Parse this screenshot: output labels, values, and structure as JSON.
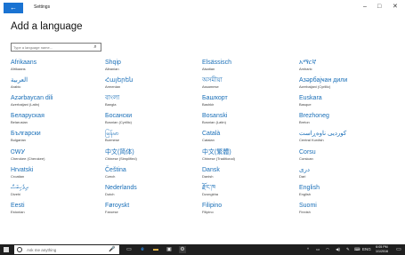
{
  "app": {
    "back_icon": "back-arrow-icon",
    "title": "Settings",
    "controls": {
      "minimize": "–",
      "maximize": "□",
      "close": "✕"
    }
  },
  "page": {
    "title": "Add a language",
    "search_placeholder": "Type a language name..."
  },
  "languages": [
    {
      "native": "Afrikaans",
      "english": "Afrikaans"
    },
    {
      "native": "Shqip",
      "english": "Albanian"
    },
    {
      "native": "Elsässisch",
      "english": "Alsatian"
    },
    {
      "native": "አማርኛ",
      "english": "Amharic"
    },
    {
      "native": "العربية",
      "english": "Arabic"
    },
    {
      "native": "Հայերեն",
      "english": "Armenian"
    },
    {
      "native": "অসমীয়া",
      "english": "Assamese"
    },
    {
      "native": "Азәрбајҹан дили",
      "english": "Azerbaijani (Cyrillic)"
    },
    {
      "native": "Azərbaycan dili",
      "english": "Azerbaijani (Latin)"
    },
    {
      "native": "বাংলা",
      "english": "Bangla"
    },
    {
      "native": "Башҡорт",
      "english": "Bashkir"
    },
    {
      "native": "Euskara",
      "english": "Basque"
    },
    {
      "native": "Беларуская",
      "english": "Belarusian"
    },
    {
      "native": "Босански",
      "english": "Bosnian (Cyrillic)"
    },
    {
      "native": "Bosanski",
      "english": "Bosnian (Latin)"
    },
    {
      "native": "Brezhoneg",
      "english": "Breton"
    },
    {
      "native": "Български",
      "english": "Bulgarian"
    },
    {
      "native": "မြန်မာ",
      "english": "Burmese"
    },
    {
      "native": "Català",
      "english": "Catalan"
    },
    {
      "native": "کوردیی ناوەڕاست",
      "english": "Central Kurdish"
    },
    {
      "native": "ᏣᎳᎩ",
      "english": "Cherokee (Cherokee)"
    },
    {
      "native": "中文(简体)",
      "english": "Chinese (Simplified)"
    },
    {
      "native": "中文(繁體)",
      "english": "Chinese (Traditional)"
    },
    {
      "native": "Corsu",
      "english": "Corsican"
    },
    {
      "native": "Hrvatski",
      "english": "Croatian"
    },
    {
      "native": "Čeština",
      "english": "Czech"
    },
    {
      "native": "Dansk",
      "english": "Danish"
    },
    {
      "native": "دری",
      "english": "Dari"
    },
    {
      "native": "ދިވެހިބަސް",
      "english": "Divehi"
    },
    {
      "native": "Nederlands",
      "english": "Dutch"
    },
    {
      "native": "རྫོང་ཁ",
      "english": "Dzongkha"
    },
    {
      "native": "English",
      "english": "English"
    },
    {
      "native": "Eesti",
      "english": "Estonian"
    },
    {
      "native": "Føroyskt",
      "english": "Faroese"
    },
    {
      "native": "Filipino",
      "english": "Filipino"
    },
    {
      "native": "Suomi",
      "english": "Finnish"
    }
  ],
  "taskbar": {
    "search_text": "Ask me anything",
    "icons": [
      "microphone-icon",
      "task-view-icon",
      "edge-icon",
      "file-explorer-icon",
      "store-icon",
      "settings-icon"
    ],
    "tray": {
      "lang": "ENG"
    },
    "clock": {
      "time": "6:05 PM",
      "date": "1/1/2016"
    }
  },
  "colors": {
    "accent": "#1a73d2",
    "link": "#1a6fb8",
    "taskbar": "#1f1f1f"
  }
}
